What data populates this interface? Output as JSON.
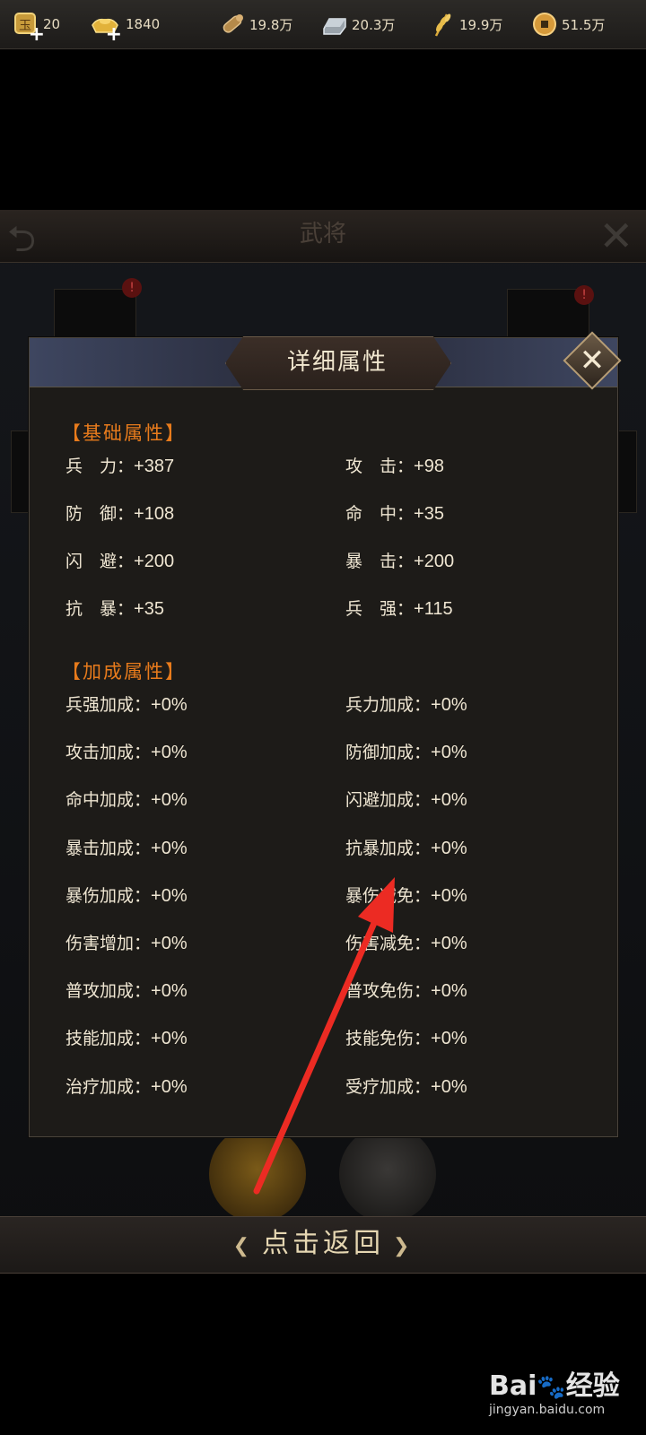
{
  "topbar": {
    "resources": [
      {
        "icon": "jade-token-icon",
        "value": "20",
        "has_plus": true
      },
      {
        "icon": "gold-ingot-icon",
        "value": "1840",
        "has_plus": true
      },
      {
        "icon": "wood-log-icon",
        "value": "19.8万"
      },
      {
        "icon": "iron-ingot-icon",
        "value": "20.3万"
      },
      {
        "icon": "wheat-icon",
        "value": "19.9万"
      },
      {
        "icon": "copper-coin-icon",
        "value": "51.5万"
      }
    ]
  },
  "background_screen": {
    "title": "武将"
  },
  "dialog": {
    "title": "详细属性",
    "basic_section": "【基础属性】",
    "basic": [
      {
        "label": "兵　力：",
        "value": "+387"
      },
      {
        "label": "攻　击：",
        "value": "+98"
      },
      {
        "label": "防　御：",
        "value": "+108"
      },
      {
        "label": "命　中：",
        "value": "+35"
      },
      {
        "label": "闪　避：",
        "value": "+200"
      },
      {
        "label": "暴　击：",
        "value": "+200"
      },
      {
        "label": "抗　暴：",
        "value": "+35"
      },
      {
        "label": "兵　强：",
        "value": "+115"
      }
    ],
    "bonus_section": "【加成属性】",
    "bonus": [
      {
        "label": "兵强加成：",
        "value": "+0%"
      },
      {
        "label": "兵力加成：",
        "value": "+0%"
      },
      {
        "label": "攻击加成：",
        "value": "+0%"
      },
      {
        "label": "防御加成：",
        "value": "+0%"
      },
      {
        "label": "命中加成：",
        "value": "+0%"
      },
      {
        "label": "闪避加成：",
        "value": "+0%"
      },
      {
        "label": "暴击加成：",
        "value": "+0%"
      },
      {
        "label": "抗暴加成：",
        "value": "+0%"
      },
      {
        "label": "暴伤加成：",
        "value": "+0%"
      },
      {
        "label": "暴伤减免：",
        "value": "+0%"
      },
      {
        "label": "伤害增加：",
        "value": "+0%"
      },
      {
        "label": "伤害减免：",
        "value": "+0%"
      },
      {
        "label": "普攻加成：",
        "value": "+0%"
      },
      {
        "label": "普攻免伤：",
        "value": "+0%"
      },
      {
        "label": "技能加成：",
        "value": "+0%"
      },
      {
        "label": "技能免伤：",
        "value": "+0%"
      },
      {
        "label": "治疗加成：",
        "value": "+0%"
      },
      {
        "label": "受疗加成：",
        "value": "+0%"
      }
    ]
  },
  "return_button": {
    "label": "点击返回"
  },
  "watermark": {
    "brand_a": "Bai",
    "brand_b": "经验",
    "url": "jingyan.baidu.com"
  },
  "colors": {
    "section_header": "#e87b1c",
    "text": "#efe6d2",
    "arrow": "#ec2b23"
  }
}
